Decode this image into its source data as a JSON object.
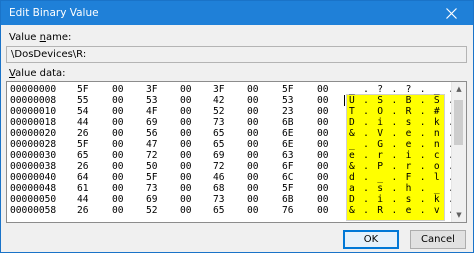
{
  "window": {
    "title": "Edit Binary Value",
    "accent": "#1f80d8"
  },
  "value_name": {
    "label_prefix": "Value ",
    "label_key": "n",
    "label_rest": "ame:",
    "value": "\\DosDevices\\R:"
  },
  "value_data": {
    "label_key": "V",
    "label_rest": "alue data:"
  },
  "rows": [
    {
      "addr": "00000000",
      "bytes": [
        "5F",
        "00",
        "3F",
        "00",
        "3F",
        "00",
        "5F",
        "00"
      ],
      "ascii": "_ . ? . ? . _ ."
    },
    {
      "addr": "00000008",
      "bytes": [
        "55",
        "00",
        "53",
        "00",
        "42",
        "00",
        "53",
        "00"
      ],
      "ascii": "U . S . B . S ."
    },
    {
      "addr": "00000010",
      "bytes": [
        "54",
        "00",
        "4F",
        "00",
        "52",
        "00",
        "23",
        "00"
      ],
      "ascii": "T . O . R . # ."
    },
    {
      "addr": "00000018",
      "bytes": [
        "44",
        "00",
        "69",
        "00",
        "73",
        "00",
        "6B",
        "00"
      ],
      "ascii": "D . i . s . k ."
    },
    {
      "addr": "00000020",
      "bytes": [
        "26",
        "00",
        "56",
        "00",
        "65",
        "00",
        "6E",
        "00"
      ],
      "ascii": "& . V . e . n ."
    },
    {
      "addr": "00000028",
      "bytes": [
        "5F",
        "00",
        "47",
        "00",
        "65",
        "00",
        "6E",
        "00"
      ],
      "ascii": "_ . G . e . n ."
    },
    {
      "addr": "00000030",
      "bytes": [
        "65",
        "00",
        "72",
        "00",
        "69",
        "00",
        "63",
        "00"
      ],
      "ascii": "e . r . i . c ."
    },
    {
      "addr": "00000038",
      "bytes": [
        "26",
        "00",
        "50",
        "00",
        "72",
        "00",
        "6F",
        "00"
      ],
      "ascii": "& . P . r . o ."
    },
    {
      "addr": "00000040",
      "bytes": [
        "64",
        "00",
        "5F",
        "00",
        "46",
        "00",
        "6C",
        "00"
      ],
      "ascii": "d . _ . F . l ."
    },
    {
      "addr": "00000048",
      "bytes": [
        "61",
        "00",
        "73",
        "00",
        "68",
        "00",
        "5F",
        "00"
      ],
      "ascii": "a . s . h . _ ."
    },
    {
      "addr": "00000050",
      "bytes": [
        "44",
        "00",
        "69",
        "00",
        "73",
        "00",
        "6B",
        "00"
      ],
      "ascii": "D . i . s . k ."
    },
    {
      "addr": "00000058",
      "bytes": [
        "26",
        "00",
        "52",
        "00",
        "65",
        "00",
        "76",
        "00"
      ],
      "ascii": "& . R . e . v ."
    }
  ],
  "buttons": {
    "ok": "OK",
    "cancel": "Cancel"
  },
  "colors": {
    "selection": "#ffff00",
    "focus_border": "#0078d7"
  }
}
